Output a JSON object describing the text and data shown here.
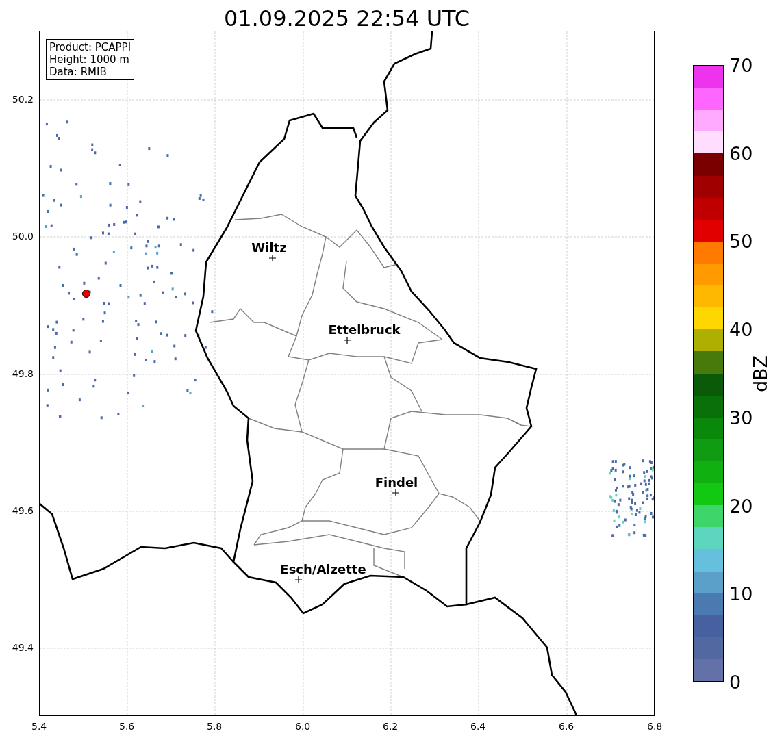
{
  "title": "01.09.2025 22:54 UTC",
  "info_box": [
    "Product: PCAPPI",
    "Height: 1000 m",
    "Data: RMIB"
  ],
  "map": {
    "x_ticks": [
      "5.4",
      "5.6",
      "5.8",
      "6.0",
      "6.2",
      "6.4",
      "6.6",
      "6.8"
    ],
    "y_ticks": [
      "50.2",
      "50.0",
      "49.8",
      "49.6",
      "49.4"
    ],
    "places": [
      {
        "name": "Wiltz"
      },
      {
        "name": "Ettelbruck"
      },
      {
        "name": "Findel"
      },
      {
        "name": "Esch/Alzette"
      }
    ]
  },
  "colorbar": {
    "label": "dBZ",
    "ticks": [
      "70",
      "60",
      "50",
      "40",
      "30",
      "20",
      "10",
      "0"
    ],
    "bands": [
      {
        "color": "#ee33ee"
      },
      {
        "color": "#ff66ff"
      },
      {
        "color": "#ffaaff"
      },
      {
        "color": "#ffddff"
      },
      {
        "color": "#7a0000"
      },
      {
        "color": "#a00000"
      },
      {
        "color": "#c00000"
      },
      {
        "color": "#e00000"
      },
      {
        "color": "#ff7a00"
      },
      {
        "color": "#ff9a00"
      },
      {
        "color": "#ffb800"
      },
      {
        "color": "#ffd700"
      },
      {
        "color": "#adb000"
      },
      {
        "color": "#477a0a"
      },
      {
        "color": "#0a5a0a"
      },
      {
        "color": "#0a700a"
      },
      {
        "color": "#0a880a"
      },
      {
        "color": "#0f9c12"
      },
      {
        "color": "#10b010"
      },
      {
        "color": "#12c812"
      },
      {
        "color": "#3cd66a"
      },
      {
        "color": "#5dd6c0"
      },
      {
        "color": "#64c0dc"
      },
      {
        "color": "#5aa0c8"
      },
      {
        "color": "#4a7ab0"
      },
      {
        "color": "#4660a0"
      },
      {
        "color": "#5268a0"
      },
      {
        "color": "#6470a8"
      }
    ]
  }
}
